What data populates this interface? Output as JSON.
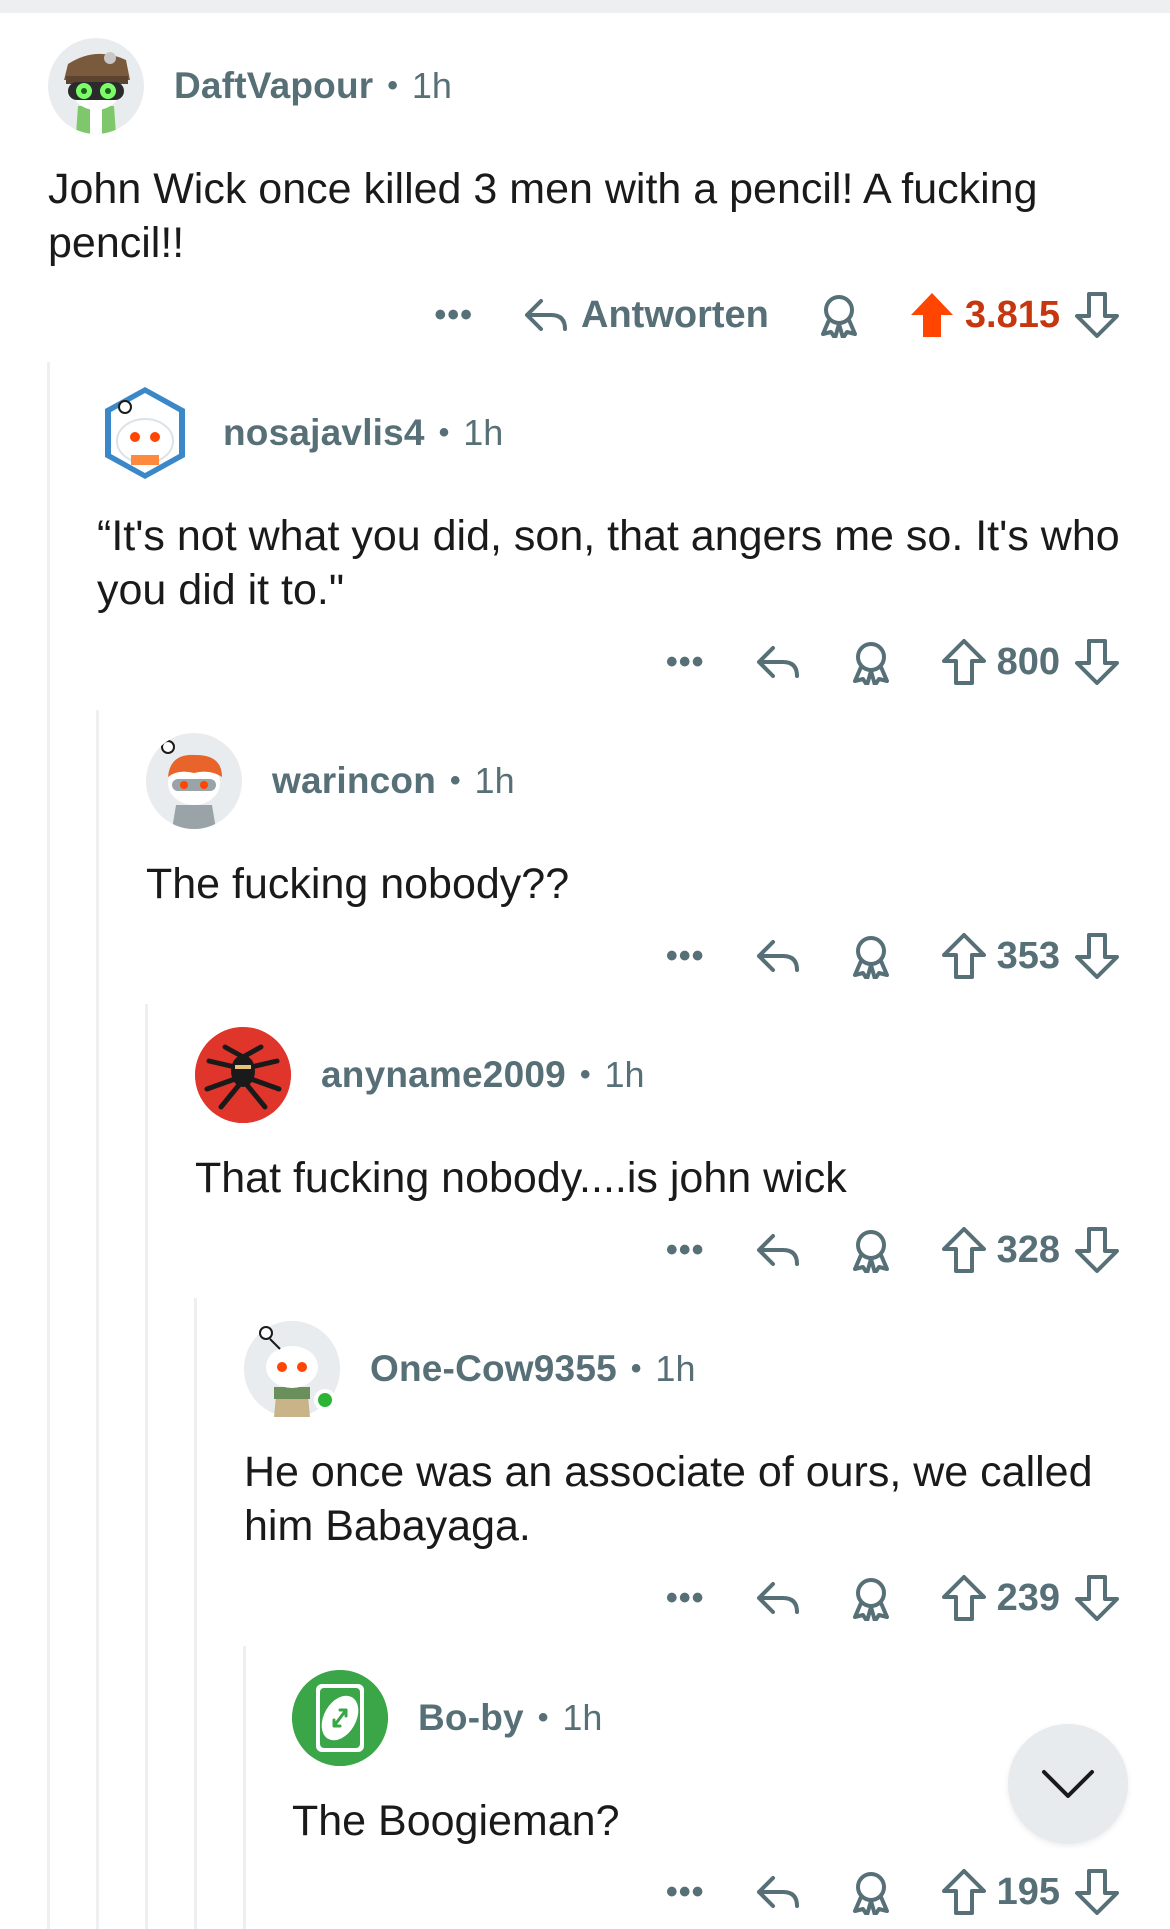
{
  "ui": {
    "reply_label": "Antworten",
    "more_label": "•••",
    "dot": "•"
  },
  "colors": {
    "upvoted": "#ff4500",
    "meta": "#576f76",
    "thread_line": "#edeff1"
  },
  "comments": [
    {
      "username": "DaftVapour",
      "time": "1h",
      "body": "John Wick once killed 3 men with a pencil! A fucking pencil!!",
      "score": "3.815",
      "upvoted": true,
      "avatar_icon": "avatar-goggles-icon"
    },
    {
      "username": "nosajavlis4",
      "time": "1h",
      "body": "“It's not what you did, son, that angers me so. It's who you did it to.\"",
      "score": "800",
      "upvoted": false,
      "avatar_icon": "avatar-snoo-hexagon-icon"
    },
    {
      "username": "warincon",
      "time": "1h",
      "body": "The fucking nobody??",
      "score": "353",
      "upvoted": false,
      "avatar_icon": "avatar-snoo-orange-hair-icon"
    },
    {
      "username": "anyname2009",
      "time": "1h",
      "body": "That fucking nobody....is john wick",
      "score": "328",
      "upvoted": false,
      "avatar_icon": "avatar-red-spider-icon"
    },
    {
      "username": "One-Cow9355",
      "time": "1h",
      "body": "He once was an associate of ours, we called him Babayaga.",
      "score": "239",
      "upvoted": false,
      "avatar_icon": "avatar-snoo-scarf-icon"
    },
    {
      "username": "Bo-by",
      "time": "1h",
      "body": "The Boogieman?",
      "score": "195",
      "upvoted": false,
      "avatar_icon": "avatar-uno-reverse-icon"
    }
  ]
}
